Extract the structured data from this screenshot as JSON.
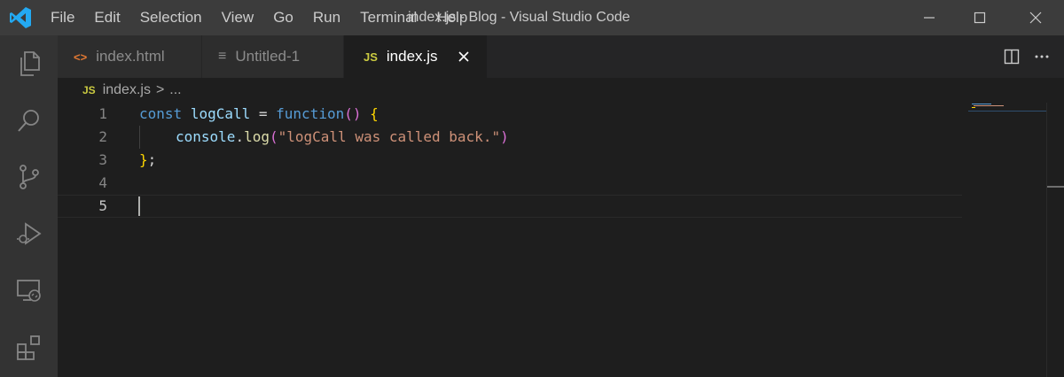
{
  "window": {
    "title": "index.js - Blog - Visual Studio Code",
    "menu": [
      "File",
      "Edit",
      "Selection",
      "View",
      "Go",
      "Run",
      "Terminal",
      "Help"
    ]
  },
  "activity_bar": {
    "icons": [
      "explorer-icon",
      "search-icon",
      "source-control-icon",
      "run-debug-icon",
      "remote-explorer-icon",
      "extensions-icon"
    ]
  },
  "tabs": [
    {
      "label": "index.html",
      "icon": "<>",
      "icon_color": "#e37933",
      "active": false
    },
    {
      "label": "Untitled-1",
      "icon": "≡",
      "icon_color": "#8c8c8c",
      "active": false
    },
    {
      "label": "index.js",
      "icon": "JS",
      "icon_color": "#cbcb41",
      "active": true
    }
  ],
  "breadcrumb": {
    "file_icon": "JS",
    "file": "index.js",
    "separator": ">",
    "more": "..."
  },
  "editor": {
    "line_numbers": [
      "1",
      "2",
      "3",
      "4",
      "5"
    ],
    "current_line": "5",
    "code": {
      "l1_kw": "const",
      "l1_name": "logCall",
      "l1_eq": " = ",
      "l1_fn": "function",
      "l1_paren": "()",
      "l1_brace": " {",
      "l2_obj": "console",
      "l2_dot": ".",
      "l2_meth": "log",
      "l2_open": "(",
      "l2_str": "\"logCall was called back.\"",
      "l2_close": ")",
      "l3_brace": "}",
      "l3_semi": ";"
    }
  },
  "colors": {
    "titlebar": "#3c3c3c",
    "activitybar": "#333333",
    "editor_bg": "#1e1e1e",
    "keyword": "#569cd6",
    "string": "#ce9178",
    "bracket": "#ffd700"
  }
}
